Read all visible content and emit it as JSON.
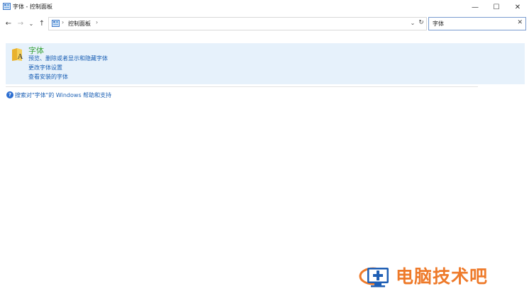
{
  "window": {
    "title": "字体 - 控制面板",
    "minimize_glyph": "—",
    "maximize_glyph": "☐",
    "close_glyph": "✕"
  },
  "nav": {
    "back_glyph": "←",
    "forward_glyph": "→",
    "recent_glyph": "⌄",
    "up_glyph": "↑"
  },
  "address_bar": {
    "breadcrumb": "控制面板",
    "separator": "›",
    "dropdown_glyph": "⌄",
    "refresh_glyph": "↻"
  },
  "search": {
    "value": "字体",
    "clear_glyph": "✕"
  },
  "result": {
    "title": "字体",
    "icon": "fonts-folder-icon",
    "links": [
      "预览、删除或者显示和隐藏字体",
      "更改字体设置",
      "查看安装的字体"
    ]
  },
  "help": {
    "icon_glyph": "?",
    "text": "搜索对\"字体\"的 Windows 帮助和支持"
  },
  "watermark": {
    "text": "电脑技术吧"
  },
  "colors": {
    "accent": "#1a5fb4",
    "result_title": "#3aa33a",
    "result_bg": "#e6f1fb",
    "watermark": "#ee7a2a"
  }
}
